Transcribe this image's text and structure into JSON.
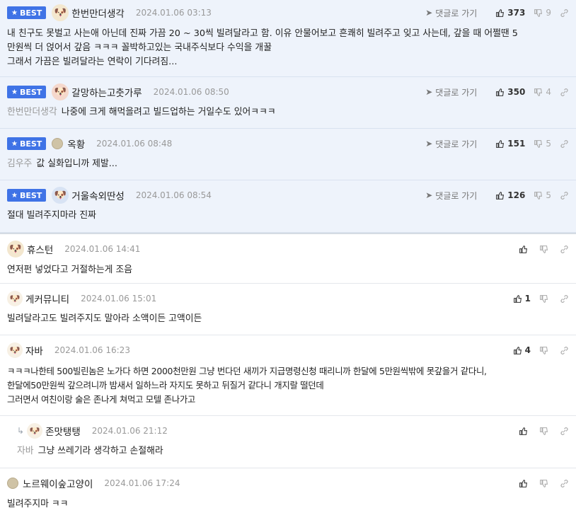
{
  "ui": {
    "badge_label": "BEST",
    "goto_label": "댓글로 가기"
  },
  "comments": [
    {
      "nick": "한번만더생각",
      "date": "2024.01.06 03:13",
      "up": "373",
      "down": "9",
      "mention": "",
      "lines": [
        "내 친구도 못벌고 사는애 아닌데 진짜 가끔 20 ~ 30씩 빌려달라고 함. 이유 안물어보고 흔쾌히 빌려주고 잊고 사는데, 갚을 때 어쩔땐 5",
        "만원씩 더 얹어서 갚음 ㅋㅋㅋ 꼴박하고있는 국내주식보다 수익을 개꿀",
        "그래서 가끔은 빌려달라는 연락이 기다려짐..."
      ]
    },
    {
      "nick": "갈망하는고춧가루",
      "date": "2024.01.06 08:50",
      "up": "350",
      "down": "4",
      "mention": "한번만더생각",
      "lines": [
        "나중에 크게 해먹을려고 빌드업하는 거일수도 있어ㅋㅋㅋ"
      ]
    },
    {
      "nick": "옥황",
      "date": "2024.01.06 08:48",
      "up": "151",
      "down": "5",
      "mention": "김우주",
      "lines": [
        "값 실화입니까 제발..."
      ]
    },
    {
      "nick": "거울속외딴성",
      "date": "2024.01.06 08:54",
      "up": "126",
      "down": "5",
      "mention": "",
      "lines": [
        "절대 빌려주지마라 진짜"
      ]
    },
    {
      "nick": "휴스턴",
      "date": "2024.01.06 14:41",
      "up": "",
      "down": "",
      "mention": "",
      "lines": [
        "연저펀 넣었다고 거절하는게 조음"
      ]
    },
    {
      "nick": "게커뮤니티",
      "date": "2024.01.06 15:01",
      "up": "1",
      "down": "",
      "mention": "",
      "lines": [
        "빌려달라고도 빌려주지도 말아라 소액이든 고액이든"
      ]
    },
    {
      "nick": "자바",
      "date": "2024.01.06 16:23",
      "up": "4",
      "down": "",
      "mention": "",
      "lines": [
        "ㅋㅋㅋ나한테 500빌린놈은 노가다 하면 2000천만원 그냥 번다던 새끼가 지급명령신청 때리니까 한달에 5만원씩밖에 못갚을거 같다니,",
        "한달에50만원씩 갚으려니까 밤새서 일하느라 자지도 못하고 뒤질거 같다니 개지랄 떨던데",
        "그러면서 여친이랑 술은 존나게 쳐먹고 모텔 존나가고"
      ]
    },
    {
      "nick": "존맛탱탱",
      "date": "2024.01.06 21:12",
      "up": "",
      "down": "",
      "mention": "자바",
      "lines": [
        "그냥 쓰레기라 생각하고 손절해라"
      ]
    },
    {
      "nick": "노르웨이숲고양이",
      "date": "2024.01.06 17:24",
      "up": "",
      "down": "",
      "mention": "",
      "lines": [
        "빌려주지마 ㅋㅋ"
      ]
    }
  ]
}
